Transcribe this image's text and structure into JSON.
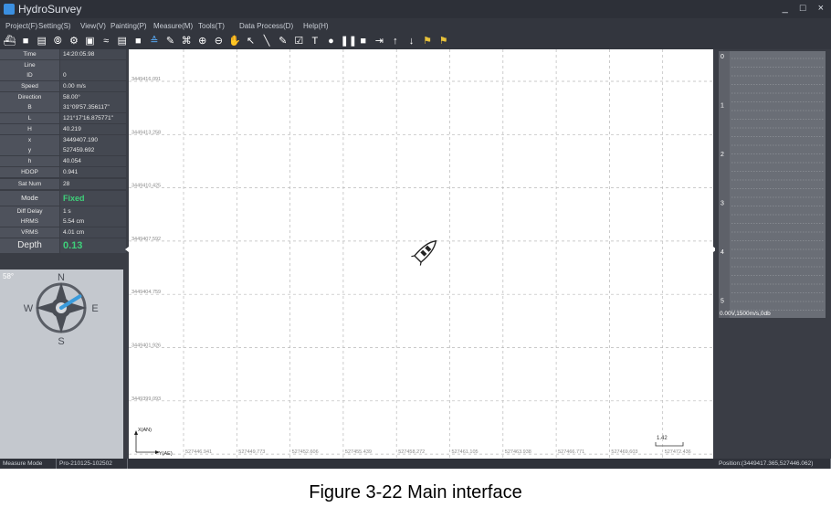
{
  "window": {
    "title": "HydroSurvey",
    "controls": [
      "_",
      "□",
      "×"
    ]
  },
  "menu": [
    {
      "label": "Project(F)"
    },
    {
      "label": "Setting(S)"
    },
    {
      "label": "View(V)"
    },
    {
      "label": "Painting(P)"
    },
    {
      "label": "Measure(M)"
    },
    {
      "label": "Tools(T)"
    },
    {
      "label": "Data Process(D)"
    },
    {
      "label": "Help(H)"
    }
  ],
  "toolbar": {
    "icons": [
      {
        "name": "boat-icon",
        "glyph": "⛴"
      },
      {
        "name": "car-icon",
        "glyph": "■"
      },
      {
        "name": "storage-icon",
        "glyph": "▤"
      },
      {
        "name": "link-icon",
        "glyph": "⦾"
      },
      {
        "name": "gear-icon",
        "glyph": "⚙"
      },
      {
        "name": "image-icon",
        "glyph": "▣"
      },
      {
        "name": "waves-icon",
        "glyph": "≈"
      },
      {
        "name": "document-icon",
        "glyph": "▤"
      },
      {
        "name": "video-icon",
        "glyph": "■"
      },
      {
        "name": "layers-icon",
        "glyph": "≙",
        "color": "blue"
      },
      {
        "name": "edit-icon",
        "glyph": "✎"
      },
      {
        "name": "fit-view-icon",
        "glyph": "⌘"
      },
      {
        "name": "zoom-in-icon",
        "glyph": "⊕"
      },
      {
        "name": "zoom-out-icon",
        "glyph": "⊖"
      },
      {
        "name": "pan-hand-icon",
        "glyph": "✋"
      },
      {
        "name": "pointer-icon",
        "glyph": "↖"
      },
      {
        "name": "line-tool-icon",
        "glyph": "╲"
      },
      {
        "name": "edit-line-icon",
        "glyph": "✎"
      },
      {
        "name": "check-edit-icon",
        "glyph": "☑"
      },
      {
        "name": "text-icon",
        "glyph": "T"
      },
      {
        "name": "record-icon",
        "glyph": "●"
      },
      {
        "name": "pause-icon",
        "glyph": "❚❚"
      },
      {
        "name": "stop-icon",
        "glyph": "■"
      },
      {
        "name": "step-icon",
        "glyph": "⇥"
      },
      {
        "name": "arrow-up-icon",
        "glyph": "↑"
      },
      {
        "name": "arrow-down-icon",
        "glyph": "↓"
      },
      {
        "name": "locate-pin-icon",
        "glyph": "⚑",
        "color": "yellow"
      },
      {
        "name": "locate-pin-2-icon",
        "glyph": "⚑",
        "color": "yellow"
      }
    ]
  },
  "info": [
    {
      "label": "Time",
      "value": "14:20:05.98"
    },
    {
      "label": "Line",
      "value": ""
    },
    {
      "label": "ID",
      "value": "0"
    },
    {
      "label": "Speed",
      "value": "0.00 m/s"
    },
    {
      "label": "Direction",
      "value": "58.00°"
    },
    {
      "label": "B",
      "value": "31°09'57.356117\""
    },
    {
      "label": "L",
      "value": "121°17'16.875771\""
    },
    {
      "label": "H",
      "value": "40.219"
    },
    {
      "label": "x",
      "value": "3449407.190"
    },
    {
      "label": "y",
      "value": "527459.692"
    },
    {
      "label": "h",
      "value": "40.054"
    }
  ],
  "info2": [
    {
      "label": "HDOP",
      "value": "0.941"
    },
    {
      "label": "Sat Num",
      "value": "28"
    }
  ],
  "mode": {
    "label": "Mode",
    "value": "Fixed"
  },
  "info3": [
    {
      "label": "Diff Delay",
      "value": "1 s"
    },
    {
      "label": "HRMS",
      "value": "5.54 cm"
    },
    {
      "label": "VRMS",
      "value": "4.01 cm"
    }
  ],
  "depth": {
    "label": "Depth",
    "value": "0.13"
  },
  "compass": {
    "heading_deg": 58,
    "heading_text": "58°",
    "n": "N",
    "s": "S",
    "e": "E",
    "w": "W"
  },
  "map": {
    "y_ticks": [
      "3449416.091",
      "3449413.258",
      "3449410.425",
      "3449407.592",
      "3449404.759",
      "3449401.926",
      "3449399.093"
    ],
    "x_ticks": [
      "527446.941",
      "527449.773",
      "527452.606",
      "527455.439",
      "527458.272",
      "527461.105",
      "527463.938",
      "527466.771",
      "527469.603",
      "527472.436"
    ],
    "axis_y_label": "X(AN)",
    "axis_x_label": "Y(AE)",
    "scale_label": "1.42"
  },
  "sounder": {
    "ticks": [
      "0",
      "1",
      "2",
      "3",
      "4",
      "5"
    ],
    "status": "0.00V,1500m/s,0db"
  },
  "status": {
    "mode": "Measure Mode",
    "project": "Pro-210125-102502",
    "position": "Position:(3449417.365,527446.062)"
  },
  "caption": "Figure 3-22 Main interface"
}
